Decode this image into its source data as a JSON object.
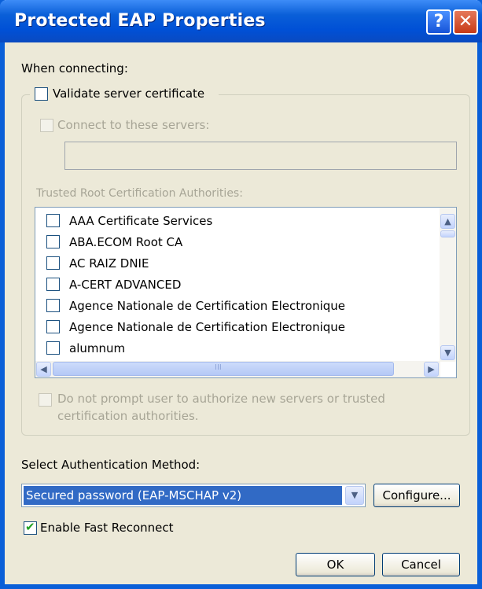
{
  "window": {
    "title": "Protected EAP Properties",
    "help_glyph": "?",
    "close_glyph": "✕"
  },
  "connecting": {
    "heading": "When connecting:",
    "validate_label": "Validate server certificate",
    "validate_checked": false,
    "connect_label": "Connect to these servers:",
    "servers_value": "",
    "trusted_heading": "Trusted Root Certification Authorities:",
    "ca_list": [
      {
        "label": "AAA Certificate Services",
        "checked": false
      },
      {
        "label": "ABA.ECOM Root CA",
        "checked": false
      },
      {
        "label": "AC RAIZ DNIE",
        "checked": false
      },
      {
        "label": "A-CERT ADVANCED",
        "checked": false
      },
      {
        "label": "Agence Nationale de Certification Electronique",
        "checked": false
      },
      {
        "label": "Agence Nationale de Certification Electronique",
        "checked": false
      },
      {
        "label": "alumnum",
        "checked": false
      }
    ],
    "scroll_up_glyph": "▲",
    "scroll_down_glyph": "▼",
    "scroll_left_glyph": "◀",
    "scroll_right_glyph": "▶",
    "thumb_grip": "III",
    "no_prompt_line1": "Do not prompt user to authorize new servers or trusted",
    "no_prompt_line2": "certification authorities."
  },
  "auth": {
    "heading": "Select Authentication Method:",
    "selected": "Secured password (EAP-MSCHAP v2)",
    "dropdown_glyph": "▼",
    "configure_label": "Configure...",
    "fast_reconnect_label": "Enable Fast Reconnect",
    "fast_reconnect_checked": true
  },
  "footer": {
    "ok_label": "OK",
    "cancel_label": "Cancel"
  },
  "colors": {
    "titlebar": "#0a5fd8",
    "dialog_bg": "#ece9d8",
    "selection": "#316ac5",
    "close_button": "#c73a16"
  }
}
